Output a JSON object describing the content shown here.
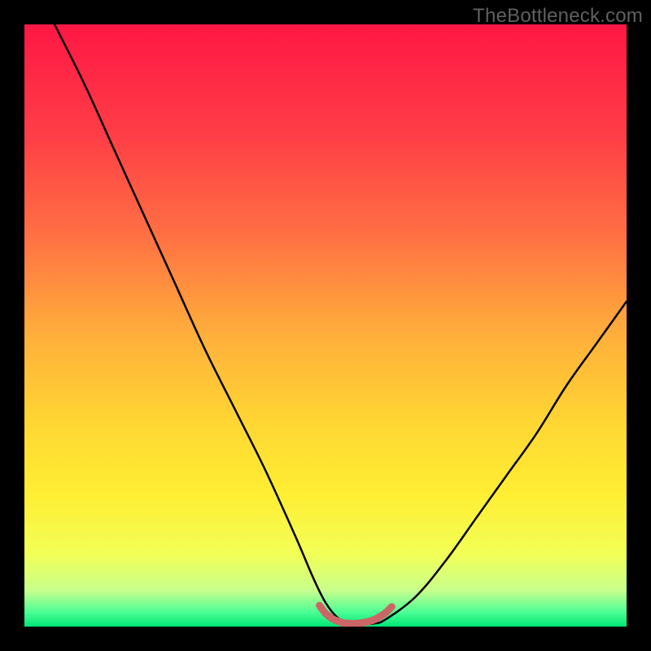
{
  "watermark": "TheBottleneck.com",
  "gradient_stops": [
    {
      "offset": 0.0,
      "color": "#ff1744"
    },
    {
      "offset": 0.18,
      "color": "#ff3d47"
    },
    {
      "offset": 0.35,
      "color": "#ff7043"
    },
    {
      "offset": 0.52,
      "color": "#ffb03b"
    },
    {
      "offset": 0.66,
      "color": "#ffd633"
    },
    {
      "offset": 0.78,
      "color": "#ffee33"
    },
    {
      "offset": 0.88,
      "color": "#f2ff57"
    },
    {
      "offset": 0.94,
      "color": "#c8ff8c"
    },
    {
      "offset": 0.975,
      "color": "#50ff96"
    },
    {
      "offset": 1.0,
      "color": "#00e676"
    }
  ],
  "chart_data": {
    "type": "line",
    "title": "",
    "xlabel": "",
    "ylabel": "",
    "xlim": [
      0,
      100
    ],
    "ylim": [
      0,
      100
    ],
    "series": [
      {
        "name": "bottleneck-curve",
        "color": "#000000",
        "width": 2.5,
        "x": [
          5,
          10,
          15,
          20,
          25,
          30,
          35,
          40,
          45,
          48,
          50,
          52,
          54,
          56,
          58,
          60,
          65,
          70,
          75,
          80,
          85,
          90,
          95,
          100
        ],
        "y": [
          100,
          90,
          79,
          68,
          57,
          46,
          36,
          26,
          15,
          8,
          4,
          1.5,
          0.6,
          0.4,
          0.5,
          1.2,
          5,
          11,
          18,
          25,
          32,
          40,
          47,
          54
        ]
      },
      {
        "name": "optimal-marker",
        "color": "#cc6666",
        "width": 9,
        "x": [
          49,
          50,
          51,
          52,
          53,
          54,
          55,
          56,
          57,
          58,
          59,
          60,
          61
        ],
        "y": [
          3.5,
          2.2,
          1.4,
          0.9,
          0.6,
          0.5,
          0.5,
          0.6,
          0.8,
          1.1,
          1.6,
          2.3,
          3.3
        ]
      }
    ]
  }
}
